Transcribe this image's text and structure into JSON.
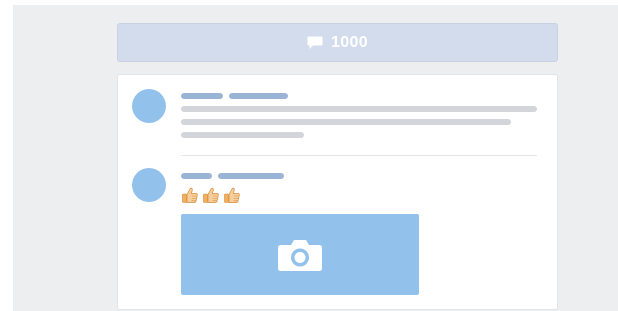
{
  "comments": {
    "count": "1000",
    "icon": "comment-icon"
  },
  "colors": {
    "page_background": "#edeef0",
    "bar_background": "#d3dcec",
    "avatar": "#92c1ec",
    "name_placeholder": "#9ab4d5",
    "text_placeholder": "#d3d5da",
    "photo_placeholder": "#92c1ec"
  },
  "posts": [
    {
      "avatar": "avatar",
      "name_placeholders": 2,
      "text_placeholder_lines": 3
    },
    {
      "avatar": "avatar",
      "name_placeholders": 2,
      "reactions": [
        "thumbs-up-icon",
        "thumbs-up-icon",
        "thumbs-up-icon"
      ],
      "attachment": "camera-icon"
    }
  ]
}
